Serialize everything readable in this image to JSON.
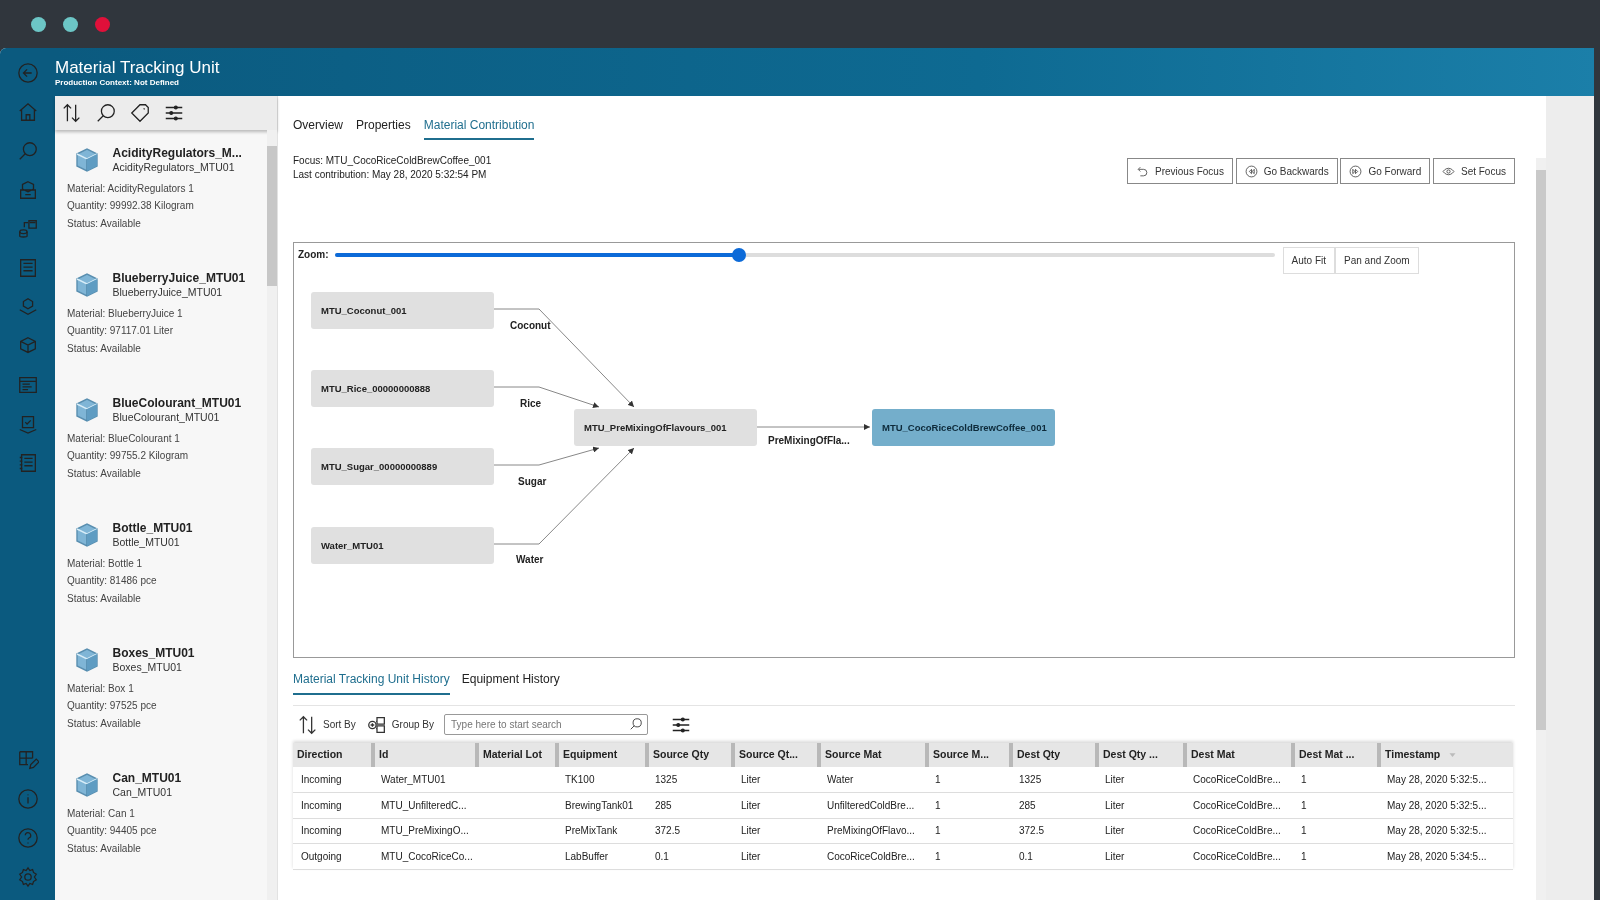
{
  "window": {
    "controls": [
      {
        "color": "#6cc6c6"
      },
      {
        "color": "#6cc6c6"
      },
      {
        "color": "#e0103a"
      }
    ]
  },
  "app": {
    "title": "Material Tracking Unit",
    "subtitle": "Production Context: Not Defined"
  },
  "list_panel": {
    "items": [
      {
        "title": "AcidityRegulators_M...",
        "subtitle": "AcidityRegulators_MTU01",
        "material": "Material: AcidityRegulators 1",
        "quantity": "Quantity: 99992.38 Kilogram",
        "status": "Status: Available"
      },
      {
        "title": "BlueberryJuice_MTU01",
        "subtitle": "BlueberryJuice_MTU01",
        "material": "Material: BlueberryJuice 1",
        "quantity": "Quantity: 97117.01 Liter",
        "status": "Status: Available"
      },
      {
        "title": "BlueColourant_MTU01",
        "subtitle": "BlueColourant_MTU01",
        "material": "Material: BlueColourant 1",
        "quantity": "Quantity: 99755.2 Kilogram",
        "status": "Status: Available"
      },
      {
        "title": "Bottle_MTU01",
        "subtitle": "Bottle_MTU01",
        "material": "Material: Bottle 1",
        "quantity": "Quantity: 81486 pce",
        "status": "Status: Available"
      },
      {
        "title": "Boxes_MTU01",
        "subtitle": "Boxes_MTU01",
        "material": "Material: Box 1",
        "quantity": "Quantity: 97525 pce",
        "status": "Status: Available"
      },
      {
        "title": "Can_MTU01",
        "subtitle": "Can_MTU01",
        "material": "Material: Can 1",
        "quantity": "Quantity: 94405 pce",
        "status": "Status: Available"
      }
    ]
  },
  "tabs": [
    {
      "label": "Overview",
      "selected": false
    },
    {
      "label": "Properties",
      "selected": false
    },
    {
      "label": "Material Contribution",
      "selected": true
    }
  ],
  "focus": "Focus: MTU_CocoRiceColdBrewCoffee_001",
  "last_contribution": "Last contribution: May 28, 2020 5:32:54 PM",
  "focus_buttons": [
    "Previous Focus",
    "Go Backwards",
    "Go Forward",
    "Set Focus"
  ],
  "graph": {
    "zoom_label": "Zoom:",
    "zoom": {
      "level": 0.43
    },
    "buttons": [
      "Auto Fit",
      "Pan and Zoom"
    ],
    "nodes": [
      {
        "label": "MTU_Coconut_001",
        "selected": false
      },
      {
        "label": "MTU_Rice_00000000888",
        "selected": false
      },
      {
        "label": "MTU_Sugar_00000000889",
        "selected": false
      },
      {
        "label": "Water_MTU01",
        "selected": false
      },
      {
        "label": "MTU_PreMixingOfFlavours_001",
        "selected": false
      },
      {
        "label": "MTU_CocoRiceColdBrewCoffee_001",
        "selected": true
      }
    ],
    "edges": [
      {
        "label": "Coconut"
      },
      {
        "label": "Rice"
      },
      {
        "label": "Sugar"
      },
      {
        "label": "Water"
      },
      {
        "label": "PreMixingOfFla..."
      }
    ]
  },
  "history_tabs": [
    {
      "label": "Material Tracking Unit History",
      "selected": true
    },
    {
      "label": "Equipment History",
      "selected": false
    }
  ],
  "history_toolbar": {
    "sort": "Sort By",
    "group": "Group By",
    "search_placeholder": "Type here to start search"
  },
  "table": {
    "columns": [
      {
        "label": "Direction",
        "sorted": false
      },
      {
        "label": "Id",
        "sorted": false
      },
      {
        "label": "Material Lot",
        "sorted": false
      },
      {
        "label": "Equipment",
        "sorted": false
      },
      {
        "label": "Source Qty",
        "sorted": false
      },
      {
        "label": "Source Qt...",
        "sorted": false
      },
      {
        "label": "Source Mat",
        "sorted": false
      },
      {
        "label": "Source M...",
        "sorted": false
      },
      {
        "label": "Dest Qty",
        "sorted": false
      },
      {
        "label": "Dest Qty ...",
        "sorted": false
      },
      {
        "label": "Dest Mat",
        "sorted": false
      },
      {
        "label": "Dest Mat ...",
        "sorted": false
      },
      {
        "label": "Timestamp",
        "sorted": true
      }
    ],
    "rows": [
      [
        "Incoming",
        "Water_MTU01",
        "",
        "TK100",
        "1325",
        "Liter",
        "Water",
        "1",
        "1325",
        "Liter",
        "CocoRiceColdBre...",
        "1",
        "May 28, 2020 5:32:5..."
      ],
      [
        "Incoming",
        "MTU_UnfilteredC...",
        "",
        "BrewingTank01",
        "285",
        "Liter",
        "UnfilteredColdBre...",
        "1",
        "285",
        "Liter",
        "CocoRiceColdBre...",
        "1",
        "May 28, 2020 5:32:5..."
      ],
      [
        "Incoming",
        "MTU_PreMixingO...",
        "",
        "PreMixTank",
        "372.5",
        "Liter",
        "PreMixingOfFlavo...",
        "1",
        "372.5",
        "Liter",
        "CocoRiceColdBre...",
        "1",
        "May 28, 2020 5:32:5..."
      ],
      [
        "Outgoing",
        "MTU_CocoRiceCo...",
        "",
        "LabBuffer",
        "0.1",
        "Liter",
        "CocoRiceColdBre...",
        "1",
        "0.1",
        "Liter",
        "CocoRiceColdBre...",
        "1",
        "May 28, 2020 5:34:5..."
      ]
    ]
  }
}
